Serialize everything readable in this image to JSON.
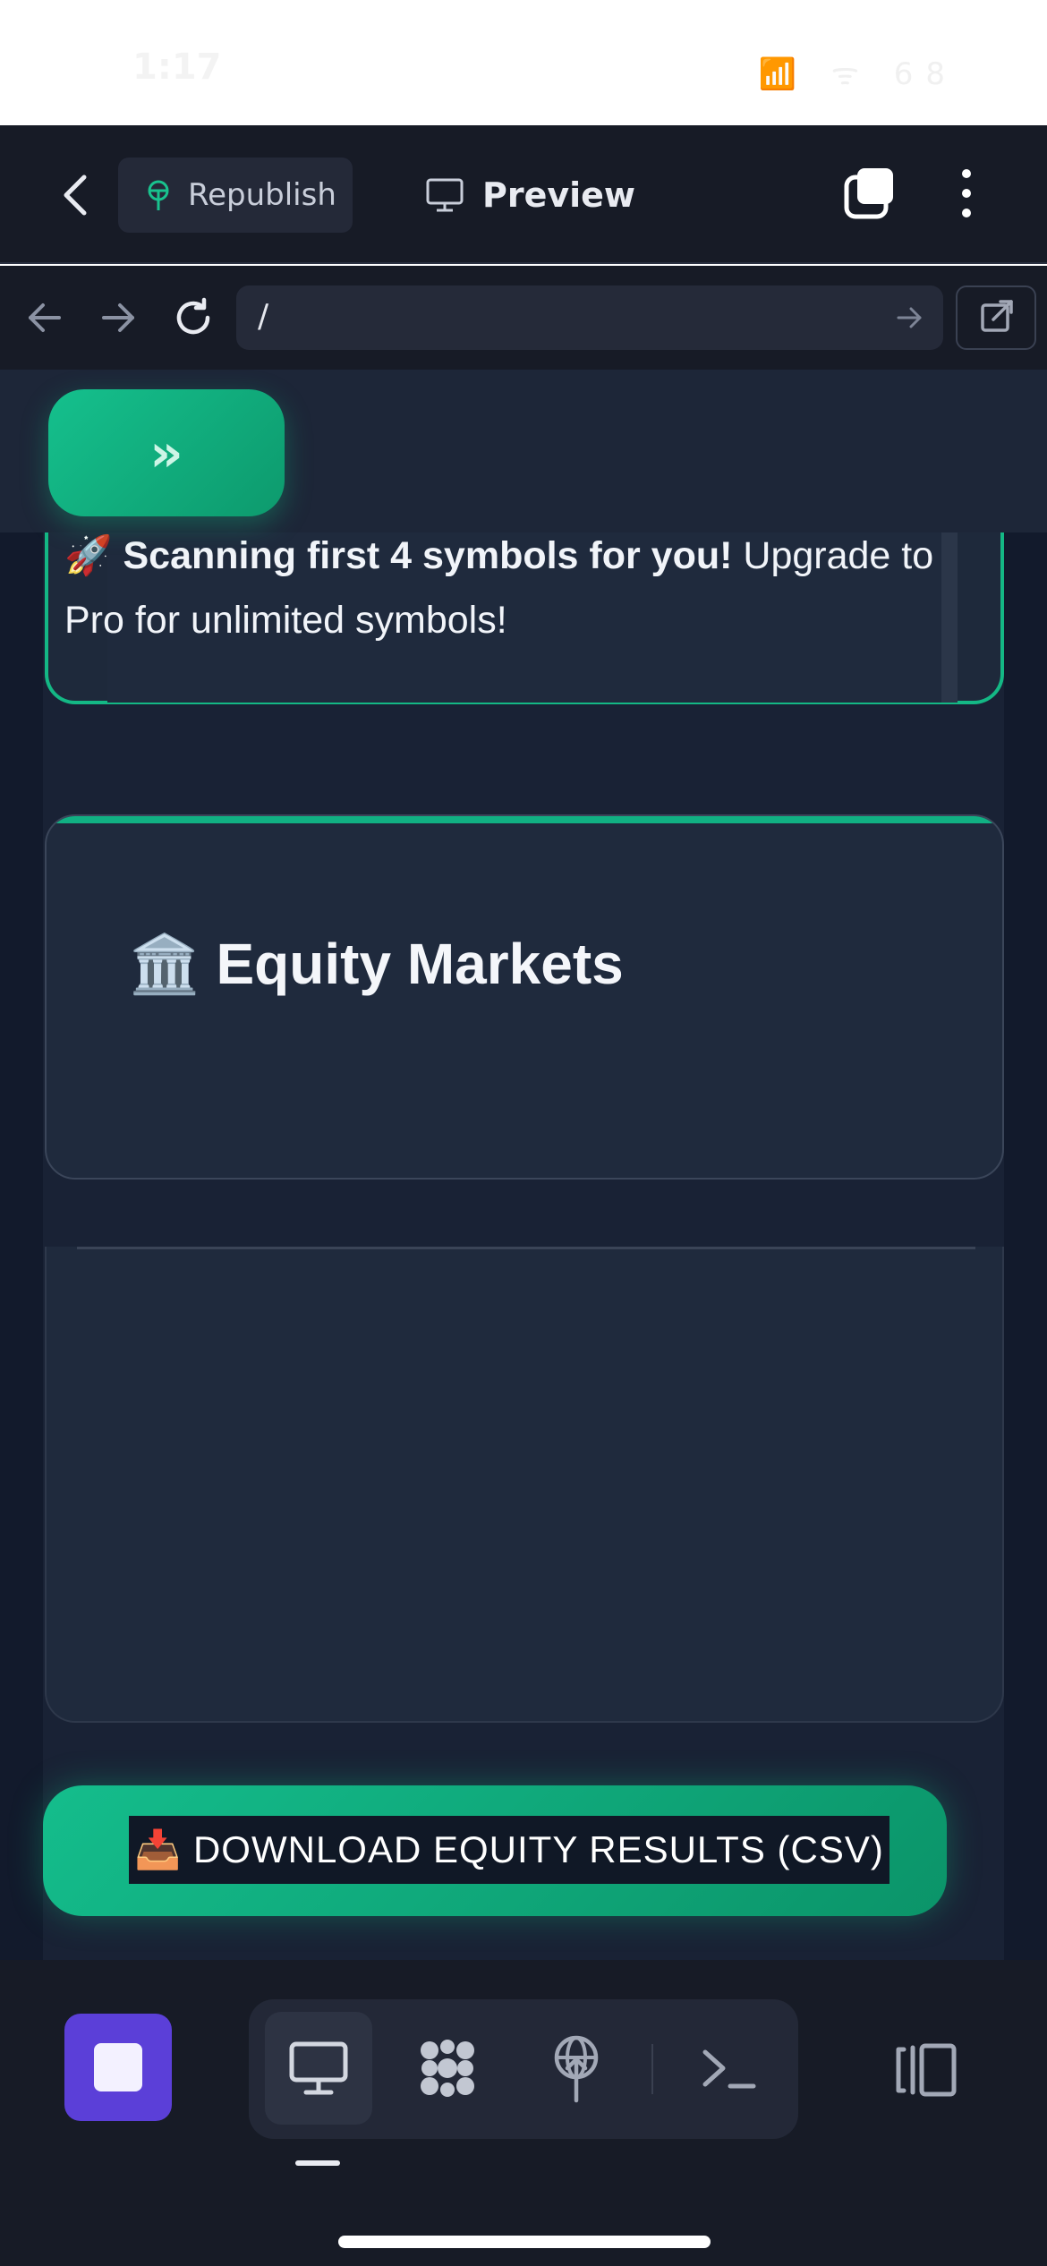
{
  "status_bar": {
    "time": "1:17",
    "icons": "📶 ᯤ 68"
  },
  "top_bar": {
    "back_icon": "chevron-left-icon",
    "republish_label": "Republish",
    "republish_icon": "broadcast-icon",
    "preview_label": "Preview",
    "preview_icon": "monitor-icon",
    "tabs_icon": "tabs-icon",
    "more_icon": "more-vertical-icon"
  },
  "url_bar": {
    "url": "/",
    "back_icon": "arrow-left-icon",
    "forward_icon": "arrow-right-icon",
    "reload_icon": "reload-icon",
    "go_icon": "arrow-right-icon",
    "external_icon": "external-link-icon"
  },
  "app": {
    "sidebar_toggle_label": "»",
    "promo": {
      "emoji": "🚀",
      "bold_text": "Scanning first 4 symbols for you!",
      "rest_text": " Upgrade to Pro for unlimited symbols!"
    },
    "equity_section": {
      "emoji": "🏛️",
      "title": "Equity Markets"
    },
    "download_button": {
      "emoji": "📥",
      "label": "DOWNLOAD EQUITY RESULTS (CSV)"
    }
  },
  "bottom_bar": {
    "stop_icon": "stop-icon",
    "tools": [
      "monitor-icon",
      "modules-icon",
      "broadcast-icon",
      "terminal-icon"
    ],
    "active_tool": "monitor-icon",
    "side_panel_icon": "side-panel-icon"
  },
  "colors": {
    "accent_green": "#10b981",
    "stop_purple": "#5b3fd8",
    "background_dark": "#171b26"
  }
}
